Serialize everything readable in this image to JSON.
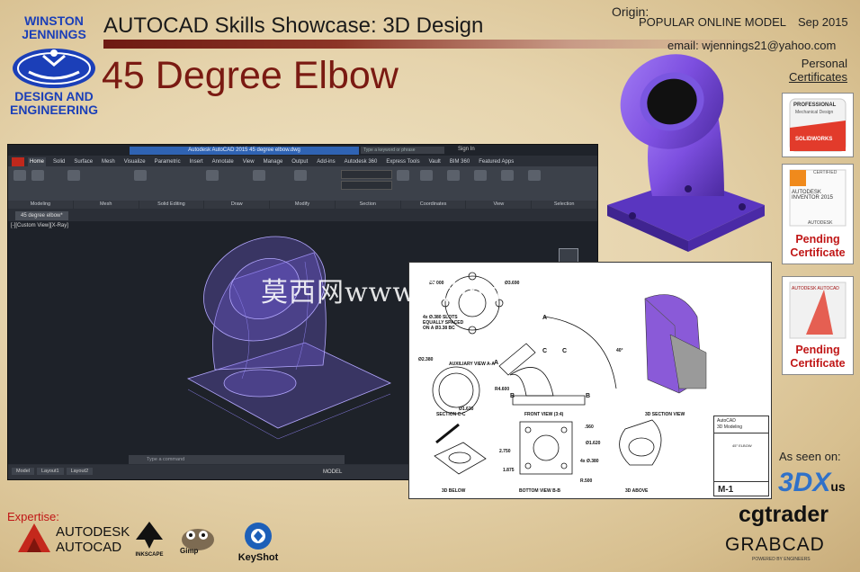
{
  "header": {
    "logo_name": "WINSTON JENNINGS",
    "logo_sub": "DESIGN AND ENGINEERING",
    "showcase_title": "AUTOCAD Skills Showcase: 3D Design",
    "part_title": "45 Degree Elbow",
    "origin_label": "Origin:",
    "origin_value": "POPULAR ONLINE MODEL",
    "date": "Sep 2015",
    "email": "email: wjennings21@yahoo.com"
  },
  "certificates": {
    "heading_1": "Personal",
    "heading_2": "Certificates",
    "items": [
      {
        "brand": "PROFESSIONAL",
        "sub": "Mechanical Design",
        "vendor": "SOLIDWORKS"
      },
      {
        "brand": "CERTIFIED",
        "sub": "AUTODESK INVENTOR 2015",
        "vendor": "AUTODESK",
        "status": "Pending Certificate"
      },
      {
        "brand": "AUTODESK AUTOCAD",
        "status": "Pending Certificate"
      }
    ]
  },
  "cad_window": {
    "title": "Autodesk AutoCAD 2015    45 degree elbow.dwg",
    "search_placeholder": "Type a keyword or phrase",
    "user": "Sign In",
    "tabs": [
      "Home",
      "Solid",
      "Surface",
      "Mesh",
      "Visualize",
      "Parametric",
      "Insert",
      "Annotate",
      "View",
      "Manage",
      "Output",
      "Add-ins",
      "Autodesk 360",
      "Express Tools",
      "Vault",
      "BIM 360",
      "Featured Apps"
    ],
    "active_tab": "Home",
    "panels": [
      "Modeling",
      "Mesh",
      "Solid Editing",
      "Draw",
      "Modify",
      "Section",
      "Coordinates",
      "View",
      "Selection"
    ],
    "file_tab": "45 degree elbow*",
    "view_label": "[-][Custom View][X-Ray]",
    "command_placeholder": "Type a command",
    "layouts": [
      "Model",
      "Layout1",
      "Layout2"
    ],
    "status_model": "MODEL"
  },
  "drawing": {
    "views": [
      "AUXILIARY VIEW A-A",
      "FRONT VIEW (3:4)",
      "3D SECTION VIEW",
      "SECTION C-C",
      "3D BELOW",
      "BOTTOM VIEW B-B",
      "3D ABOVE"
    ],
    "dims": [
      "Ø3.000",
      "Ø3.690",
      "Ø2.380",
      "4x Ø.380 SLOTS EQUALLY SPACED ON A Ø3.38 BC",
      "40°",
      "R4.600",
      "Ø1.620",
      "2.750",
      "1.875",
      "Ø1.620",
      "4x Ø.380",
      "R.500",
      ".560"
    ],
    "labels": [
      "A",
      "A",
      "B",
      "B",
      "C",
      "C"
    ],
    "title_block_app": "AutoCAD",
    "title_block_sub": "3D Modeling",
    "title_block_name": "45° ELBOW",
    "sheet_number": "M-1"
  },
  "watermark": "莫西网www.3dmox.com",
  "footer": {
    "expertise_label": "Expertise:",
    "autocad_1": "AUTODESK",
    "autocad_2": "AUTOCAD",
    "tools": [
      "INKSCAPE",
      "Gimp",
      "KeyShot"
    ],
    "seen_on": "As seen on:",
    "x3d": "3DX",
    "x3d_us": "us",
    "cgtrader": "cgtrader",
    "grabcad": "GRABCAD",
    "grabcad_sub": "POWERED BY ENGINEERS"
  },
  "colors": {
    "brand_blue": "#1b3fb8",
    "title_red": "#7a1a12",
    "pending_red": "#c01616",
    "model_purple": "#7d4fe0"
  }
}
